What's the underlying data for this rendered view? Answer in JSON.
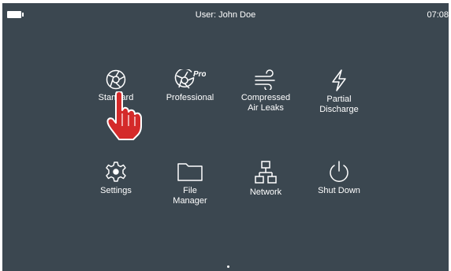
{
  "status_bar": {
    "user": "User: John Doe",
    "time": "07:08",
    "battery_icon": "battery-icon"
  },
  "menu": {
    "row1": [
      {
        "label": "Standard",
        "icon": "aperture-icon"
      },
      {
        "label": "Professional",
        "icon": "aperture-pro-icon",
        "badge": "Pro"
      },
      {
        "label": "Compressed\nAir Leaks",
        "icon": "wind-icon"
      },
      {
        "label": "Partial\nDischarge",
        "icon": "lightning-icon"
      }
    ],
    "row2": [
      {
        "label": "Settings",
        "icon": "gear-icon"
      },
      {
        "label": "File\nManager",
        "icon": "folder-icon"
      },
      {
        "label": "Network",
        "icon": "network-icon"
      },
      {
        "label": "Shut Down",
        "icon": "power-icon"
      }
    ]
  },
  "colors": {
    "background": "#3b4750",
    "foreground": "#ffffff",
    "pointer_hand": "#d42a2a"
  },
  "pager": {
    "current_page": 1
  }
}
